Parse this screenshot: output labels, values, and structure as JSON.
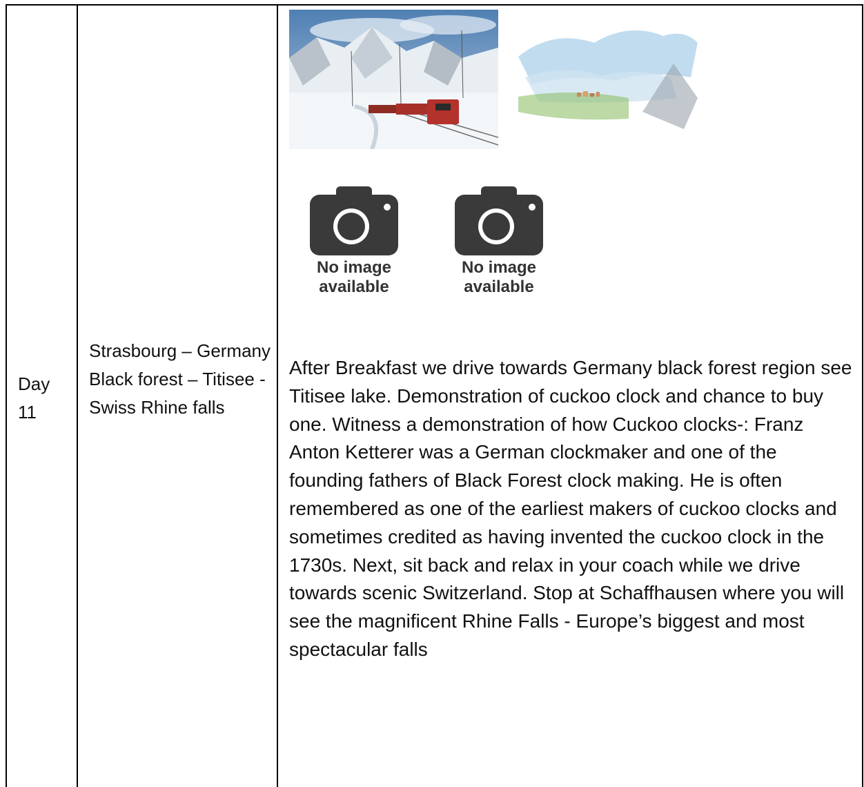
{
  "row": {
    "day": "Day 11",
    "route": "Strasbourg – Germany Black forest – Titisee - Swiss Rhine falls",
    "placeholder_text": "No image available",
    "description": "After Breakfast we drive towards Germany black forest region see Titisee lake. Demonstration of cuckoo clock and chance to buy one. Witness a demonstration of how Cuckoo clocks-: Franz Anton Ketterer was a German clockmaker and one of the founding fathers of Black Forest clock making. He is often remembered as one of the earliest makers of cuckoo clocks and sometimes credited as having invented the cuckoo clock in the 1730s. Next, sit back and relax in your coach while we drive towards scenic Switzerland. Stop at Schaffhausen where you will see the magnificent Rhine Falls - Europe’s biggest and most spectacular falls"
  },
  "images": {
    "photo_icon": "train-in-snowy-mountains-photo",
    "illustration_icon": "watercolor-landscape-illustration",
    "placeholder_icon": "camera-icon"
  },
  "colors": {
    "border": "#000000",
    "camera": "#3a3a3a",
    "text": "#111111"
  }
}
